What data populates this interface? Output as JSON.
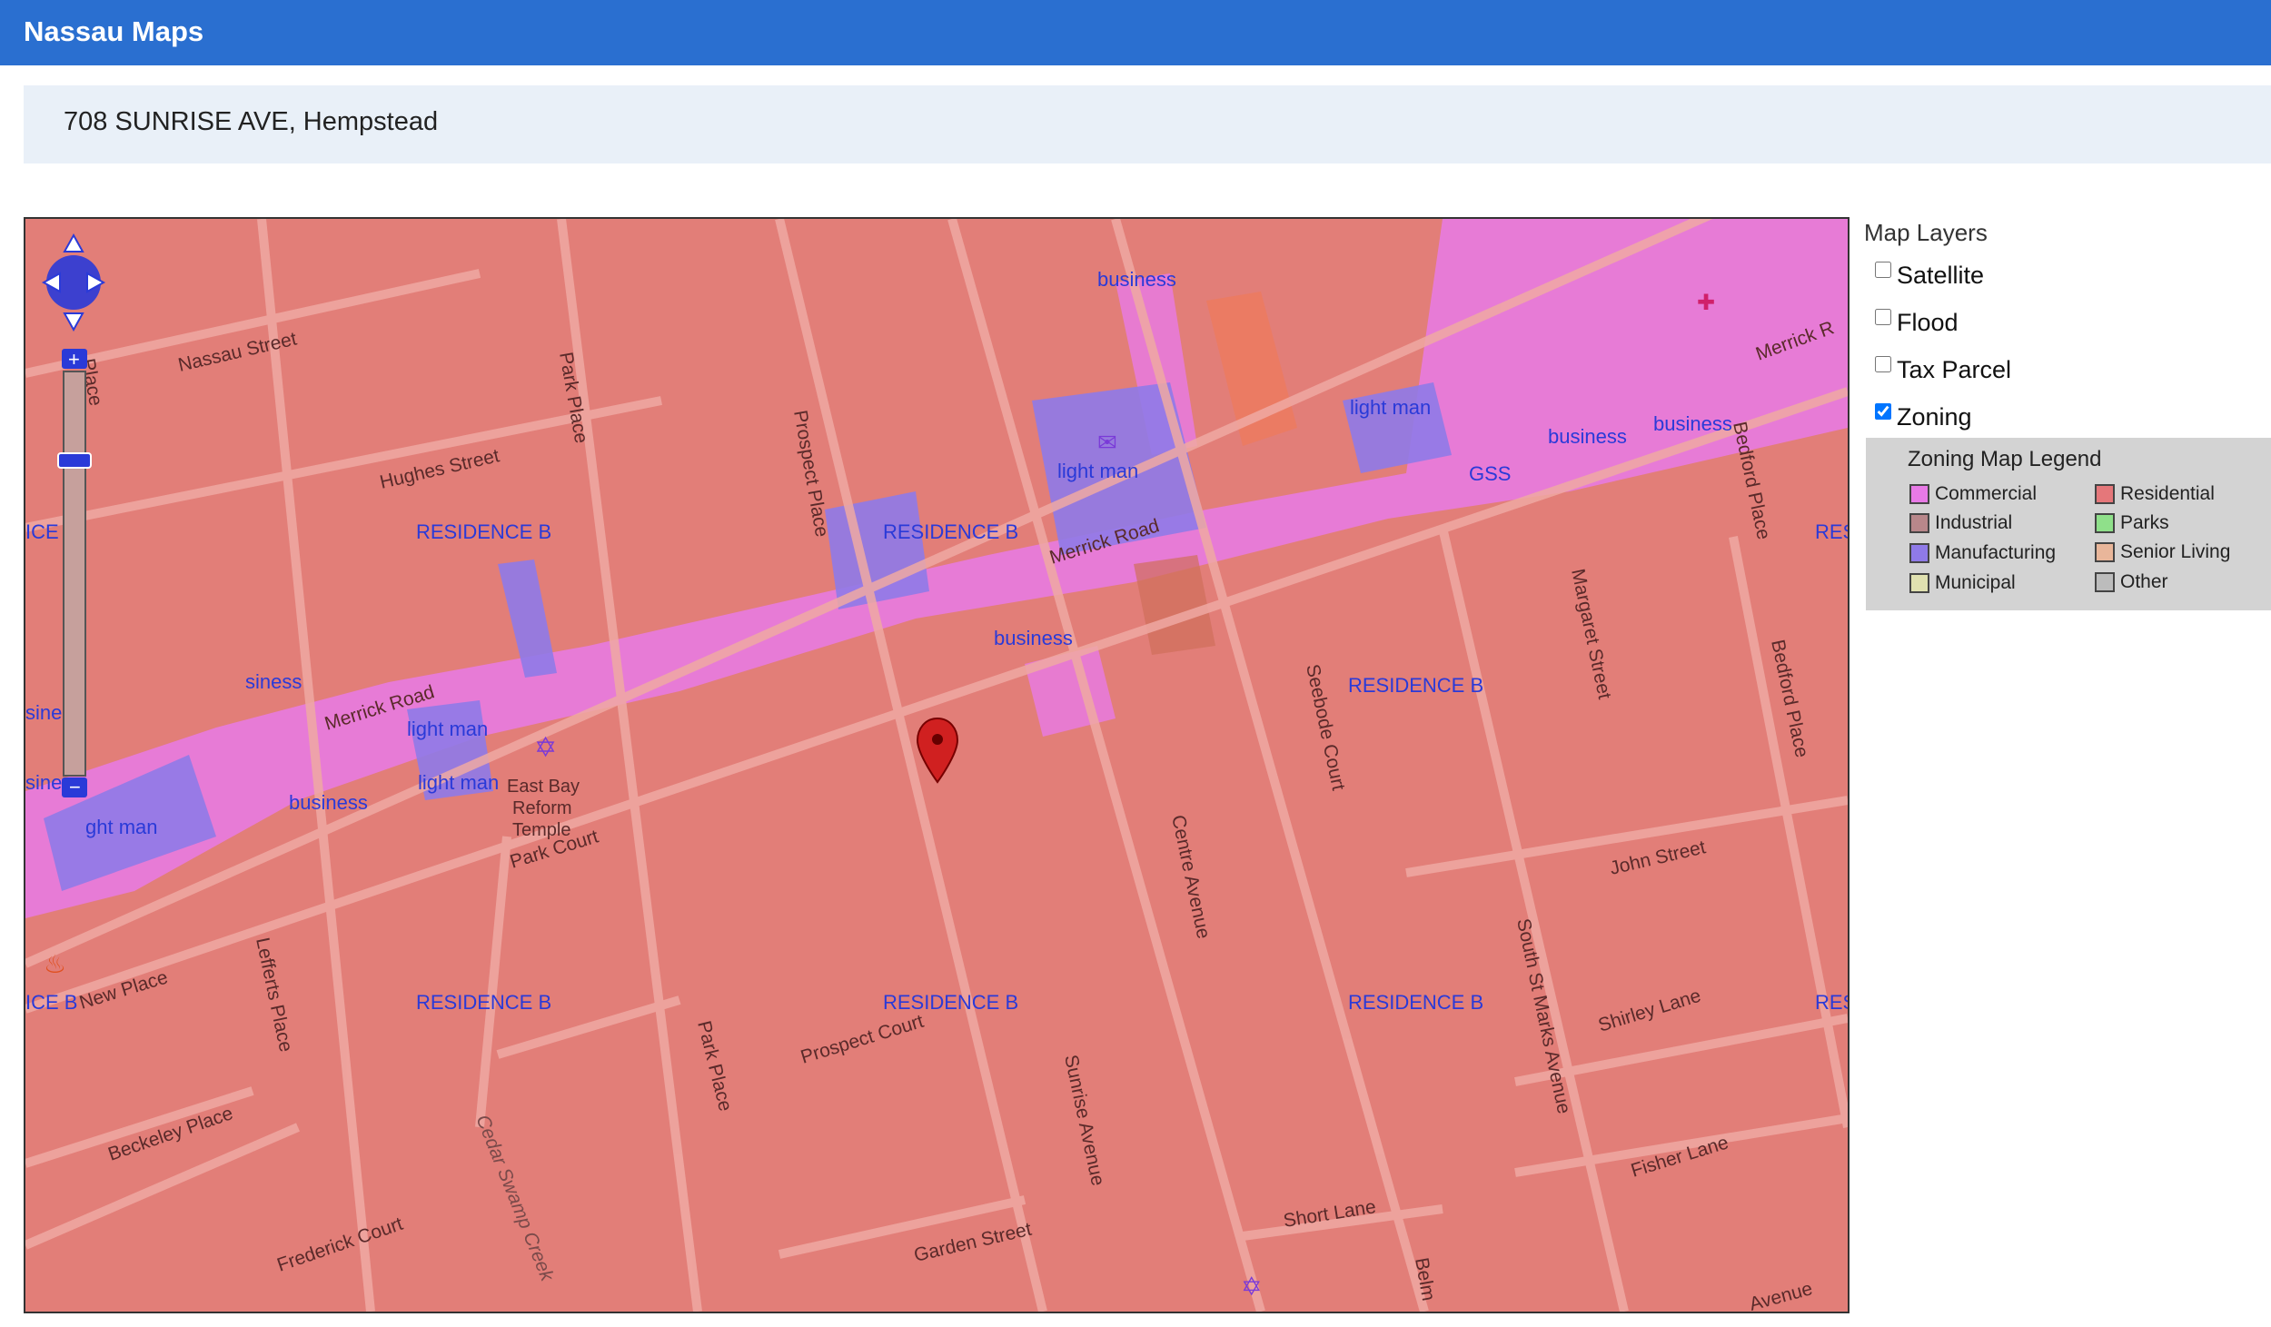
{
  "header": {
    "title": "Nassau Maps"
  },
  "address": {
    "text": "708 SUNRISE AVE, Hempstead"
  },
  "layers_panel": {
    "title": "Map Layers",
    "layers": [
      {
        "label": "Satellite",
        "checked": false
      },
      {
        "label": "Flood",
        "checked": false
      },
      {
        "label": "Tax Parcel",
        "checked": false
      },
      {
        "label": "Zoning",
        "checked": true
      }
    ]
  },
  "legend": {
    "title": "Zoning Map Legend",
    "items": [
      {
        "label": "Commercial",
        "color": "#e87ae6"
      },
      {
        "label": "Industrial",
        "color": "#b8878a"
      },
      {
        "label": "Manufacturing",
        "color": "#8f7ae8"
      },
      {
        "label": "Municipal",
        "color": "#e0e1b0"
      },
      {
        "label": "Residential",
        "color": "#e5777a"
      },
      {
        "label": "Parks",
        "color": "#8fe08a"
      },
      {
        "label": "Senior Living",
        "color": "#e9b69a"
      },
      {
        "label": "Other",
        "color": "#bcbcbc"
      }
    ]
  },
  "map": {
    "zones": {
      "residence_b": "RESIDENCE B",
      "ce_b": "ICE B",
      "res": "RES",
      "business": "business",
      "siness": "siness",
      "light_man": "light man",
      "ght_man": "ght man",
      "gss": "GSS"
    },
    "streets": {
      "nassau": "Nassau Street",
      "hughes": "Hughes Street",
      "merrick": "Merrick Road",
      "merrick_r": "Merrick R",
      "park_place": "Park Place",
      "prospect_place": "Prospect Place",
      "park_court": "Park Court",
      "new_place": "New Place",
      "lefferts": "Lefferts Place",
      "beckeley": "Beckeley Place",
      "frederick": "Frederick Court",
      "prospect_court": "Prospect Court",
      "garden": "Garden Street",
      "sunrise": "Sunrise Avenue",
      "centre": "Centre Avenue",
      "seebode": "Seebode Court",
      "margaret": "Margaret Street",
      "south_st_marks": "South St Marks Avenue",
      "bedford": "Bedford Place",
      "bedford_top": "Bedford Place",
      "john": "John Street",
      "shirley": "Shirley Lane",
      "fisher": "Fisher Lane",
      "short": "Short Lane",
      "belm": "Belm",
      "avenue": "Avenue",
      "cedar_swamp": "Cedar Swamp Creek",
      "place_left": "Place"
    },
    "poi": {
      "temple_l1": "East Bay",
      "temple_l2": "Reform",
      "temple_l3": "Temple"
    },
    "selected_address": "708 SUNRISE AVE"
  }
}
